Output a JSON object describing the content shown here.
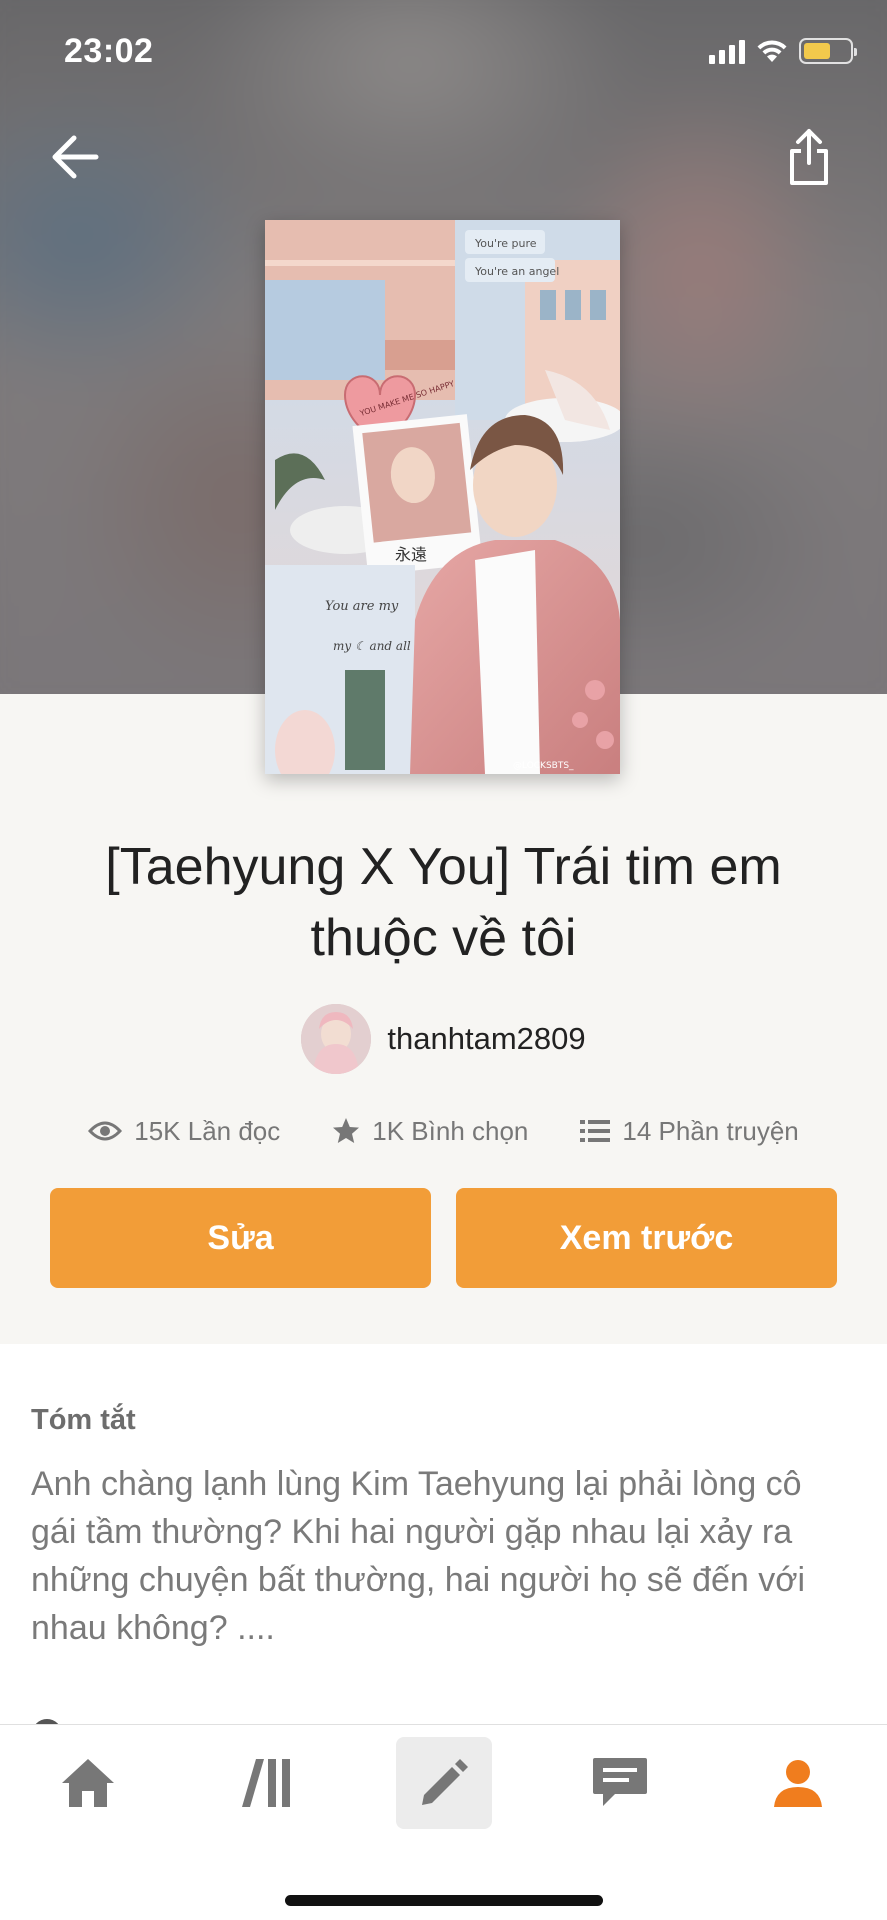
{
  "status_bar": {
    "time": "23:02"
  },
  "book": {
    "title": "[Taehyung X You] Trái tim em thuộc về tôi",
    "cover_texts": {
      "pure": "You're pure",
      "angel": "You're an angel",
      "heart": "YOU MAKE ME SO HAPPY",
      "kanji": "永遠",
      "you_are_my": "You are my",
      "my_and_all": "my ☾ and all my",
      "watermark": "@LOCKSBTS_"
    },
    "author": "thanhtam2809",
    "stats": {
      "reads": "15K Lần đọc",
      "votes": "1K Bình chọn",
      "parts": "14 Phần truyện"
    },
    "buttons": {
      "edit": "Sửa",
      "preview": "Xem trước"
    }
  },
  "summary": {
    "heading": "Tóm tắt",
    "text": "Anh chàng lạnh lùng Kim Taehyung lại phải lòng cô gái tầm thường? Khi hai người gặp nhau lại xảy ra những chuyện bất thường, hai người họ sẽ đến với nhau không? ...."
  },
  "tabbar": {
    "items": [
      {
        "icon": "home-icon",
        "active": false
      },
      {
        "icon": "library-icon",
        "active": false
      },
      {
        "icon": "pencil-icon",
        "active": true
      },
      {
        "icon": "messages-icon",
        "active": false
      },
      {
        "icon": "profile-icon",
        "active": false,
        "color": "#f07d1e"
      }
    ]
  },
  "colors": {
    "accent": "#f29d38",
    "profile_accent": "#f07d1e",
    "icon_gray": "#777777"
  }
}
